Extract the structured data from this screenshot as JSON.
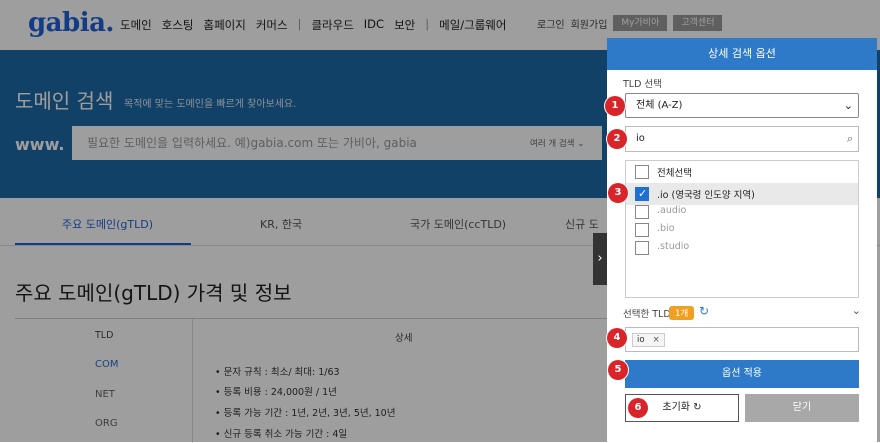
{
  "header": {
    "logo": "gabia.",
    "nav": [
      "도메인",
      "호스팅",
      "홈페이지",
      "커머스",
      "|",
      "클라우드",
      "IDC",
      "보안",
      "|",
      "메일/그룹웨어"
    ],
    "login": "로그인",
    "signup": "회원가입",
    "my": "My가비아",
    "support": "고객센터"
  },
  "hero": {
    "title": "도메인 검색",
    "subtitle": "목적에 맞는 도메인을 빠르게 찾아보세요.",
    "www": "www.",
    "placeholder": "필요한 도메인을 입력하세요. 예)gabia.com 또는 가비아, gabia",
    "multi": "여러 개 검색 ⌄"
  },
  "tabs": [
    "주요 도메인(gTLD)",
    "KR, 한국",
    "국가 도메인(ccTLD)",
    "신규 도"
  ],
  "section_title": "주요 도메인(gTLD) 가격 및 정보",
  "table": {
    "headers": [
      "TLD",
      "상세"
    ],
    "tlds": [
      "COM",
      "NET",
      "ORG"
    ],
    "details": [
      "• 문자 규칙 : 최소/ 최대: 1/63",
      "• 등록 비용 : 24,000원 / 1년",
      "• 등록 가능 기간 : 1년, 2년, 3년, 5년, 10년",
      "• 신규 등록 취소 가능 기간 : 4일"
    ]
  },
  "panel": {
    "title": "상세 검색 옵션",
    "tld_label": "TLD 선택",
    "sort_value": "전체 (A-Z)",
    "search_value": "io",
    "list": [
      {
        "label": "전체선택",
        "checked": false
      },
      {
        "label": ".io (영국령 인도양 지역)",
        "checked": true
      },
      {
        "label": ".audio",
        "checked": false
      },
      {
        "label": ".bio",
        "checked": false
      },
      {
        "label": ".studio",
        "checked": false
      }
    ],
    "selected_label": "선택한 TLD",
    "selected_count": "1개",
    "chip": "io",
    "apply": "옵션 적용",
    "reset": "초기화 ↻",
    "close": "닫기"
  },
  "markers": [
    "1",
    "2",
    "3",
    "4",
    "5",
    "6"
  ],
  "colors": {
    "brand": "#1f62d8",
    "hero": "#1e6aa6",
    "accent": "#2e7ac8",
    "marker": "#d9252a",
    "badge": "#f0a020"
  },
  "icons": {
    "search": "search-icon",
    "refresh": "refresh-icon",
    "chevron": "chevron-down-icon",
    "close": "close-icon",
    "expand": "chevron-right-icon"
  }
}
